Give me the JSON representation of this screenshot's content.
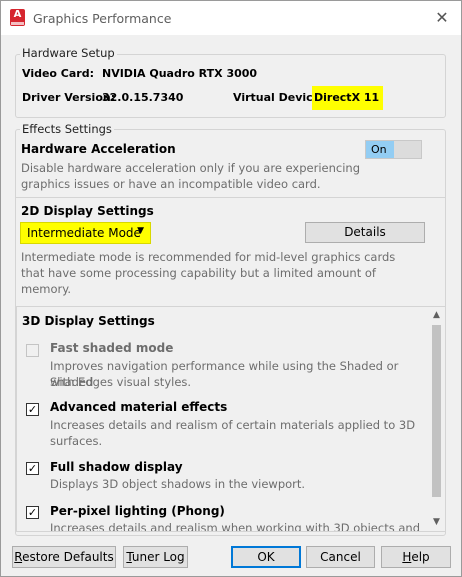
{
  "window": {
    "title": "Graphics Performance",
    "app_icon_letter": "A",
    "close_glyph": "✕"
  },
  "hardware": {
    "legend": "Hardware Setup",
    "video_card_label": "Video Card:",
    "video_card_value": "NVIDIA Quadro RTX 3000",
    "driver_label": "Driver Version:",
    "driver_value": "32.0.15.7340",
    "virtual_device_label": "Virtual Device:",
    "virtual_device_value": "DirectX 11"
  },
  "effects": {
    "legend": "Effects Settings",
    "hw_accel_title": "Hardware Acceleration",
    "hw_accel_desc_1": "Disable hardware acceleration only if you are experiencing",
    "hw_accel_desc_2": "graphics issues or have an incompatible video card.",
    "hw_accel_toggle": "On",
    "display2d_title": "2D Display Settings",
    "mode_selected": "Intermediate Mode",
    "details_button": "Details",
    "mode_desc_1": "Intermediate mode is recommended for mid-level graphics cards",
    "mode_desc_2": "that have some processing capability but a limited amount of",
    "mode_desc_3": "memory."
  },
  "display3d": {
    "title": "3D Display Settings",
    "options": [
      {
        "label": "Fast shaded mode",
        "checked": false,
        "disabled": true,
        "desc_1": "Improves navigation performance while using the Shaded or Shaded",
        "desc_2": "with Edges visual styles."
      },
      {
        "label": "Advanced material effects",
        "checked": true,
        "disabled": false,
        "desc_1": "Increases details and realism of certain materials applied to 3D",
        "desc_2": "surfaces."
      },
      {
        "label": "Full shadow display",
        "checked": true,
        "disabled": false,
        "desc_1": "Displays 3D object shadows in the viewport.",
        "desc_2": ""
      },
      {
        "label": "Per-pixel lighting (Phong)",
        "checked": true,
        "disabled": false,
        "desc_1": "Increases details and realism when working with 3D objects and",
        "desc_2": ""
      }
    ],
    "check_glyph": "✓"
  },
  "footer": {
    "restore_first": "R",
    "restore_rest": "estore Defaults",
    "tuner_first": "T",
    "tuner_rest": "uner Log",
    "ok": "OK",
    "cancel": "Cancel",
    "help_first": "H",
    "help_rest": "elp"
  },
  "colors": {
    "highlight": "#ffff00",
    "toggle_on": "#93cdf3",
    "app_icon": "#d6262f"
  }
}
